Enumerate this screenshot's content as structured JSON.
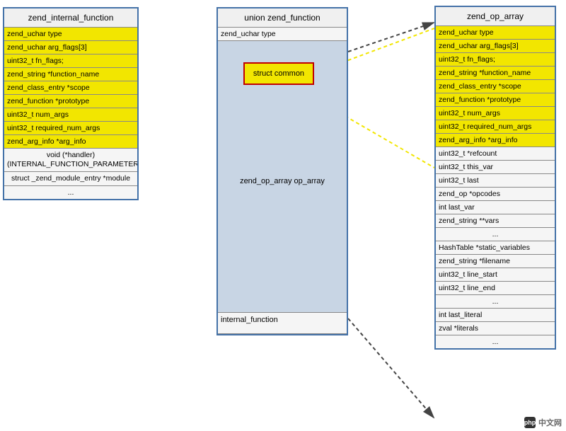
{
  "left": {
    "title": "zend_internal_function",
    "rows": [
      {
        "text": "zend_uchar type",
        "yellow": true
      },
      {
        "text": "zend_uchar arg_flags[3]",
        "yellow": true
      },
      {
        "text": "uint32_t fn_flags;",
        "yellow": true
      },
      {
        "text": "zend_string *function_name",
        "yellow": true
      },
      {
        "text": "zend_class_entry *scope",
        "yellow": true
      },
      {
        "text": "zend_function *prototype",
        "yellow": true
      },
      {
        "text": "uint32_t num_args",
        "yellow": true
      },
      {
        "text": "uint32_t required_num_args",
        "yellow": true
      },
      {
        "text": "zend_arg_info *arg_info",
        "yellow": true
      },
      {
        "text": "void (*handler)(INTERNAL_FUNCTION_PARAMETERS)",
        "yellow": false,
        "center": true,
        "multi": true
      },
      {
        "text": "struct _zend_module_entry *module",
        "yellow": false,
        "center": true,
        "multi": true
      },
      {
        "text": "...",
        "yellow": false,
        "center": true
      }
    ]
  },
  "middle": {
    "title": "union zend_function",
    "type_row": "zend_uchar type",
    "struct_common_label": "struct common",
    "op_array_label": "zend_op_array op_array",
    "internal_function_label": "internal_function"
  },
  "right": {
    "title": "zend_op_array",
    "rows": [
      {
        "text": "zend_uchar type",
        "yellow": true
      },
      {
        "text": "zend_uchar arg_flags[3]",
        "yellow": true
      },
      {
        "text": "uint32_t fn_flags;",
        "yellow": true
      },
      {
        "text": "zend_string *function_name",
        "yellow": true
      },
      {
        "text": "zend_class_entry *scope",
        "yellow": true
      },
      {
        "text": "zend_function *prototype",
        "yellow": true
      },
      {
        "text": "uint32_t num_args",
        "yellow": true
      },
      {
        "text": "uint32_t required_num_args",
        "yellow": true
      },
      {
        "text": "zend_arg_info *arg_info",
        "yellow": true
      },
      {
        "text": "uint32_t *refcount",
        "yellow": false
      },
      {
        "text": "uint32_t this_var",
        "yellow": false
      },
      {
        "text": "uint32_t last",
        "yellow": false
      },
      {
        "text": "zend_op *opcodes",
        "yellow": false
      },
      {
        "text": "int last_var",
        "yellow": false
      },
      {
        "text": "zend_string **vars",
        "yellow": false
      },
      {
        "text": "...",
        "yellow": false,
        "center": true
      },
      {
        "text": "HashTable *static_variables",
        "yellow": false
      },
      {
        "text": "zend_string *filename",
        "yellow": false
      },
      {
        "text": "uint32_t line_start",
        "yellow": false
      },
      {
        "text": "uint32_t line_end",
        "yellow": false
      },
      {
        "text": "...",
        "yellow": false,
        "center": true
      },
      {
        "text": "int last_literal",
        "yellow": false
      },
      {
        "text": "zval *literals",
        "yellow": false
      },
      {
        "text": "...",
        "yellow": false,
        "center": true
      }
    ]
  },
  "watermark": {
    "logo": "php",
    "text": "中文网"
  }
}
